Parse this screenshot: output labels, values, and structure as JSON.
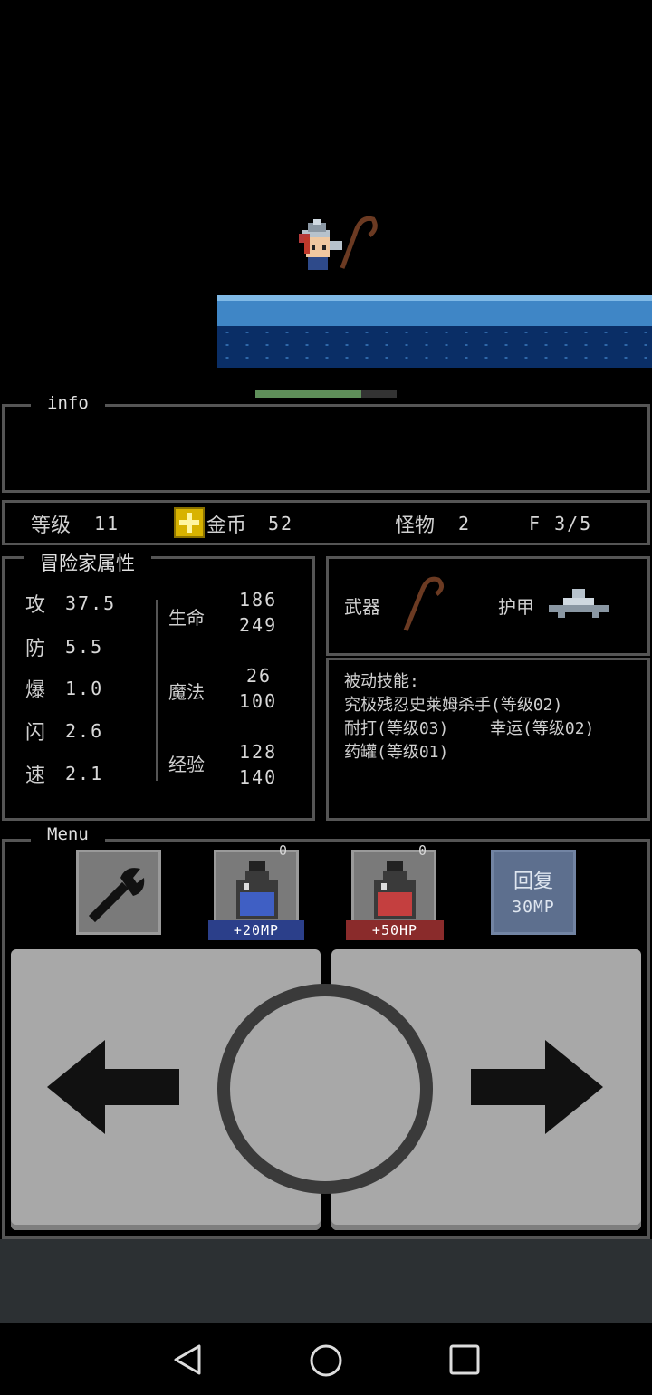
{
  "info": {
    "title": "info"
  },
  "status": {
    "level_label": "等级",
    "level_value": "11",
    "gold_label": "金币",
    "gold_value": "52",
    "monster_label": "怪物",
    "monster_value": "2",
    "floor": "F 3/5"
  },
  "hero_hp_fraction": 0.75,
  "attributes": {
    "title": "冒险家属性",
    "stats": [
      {
        "label": "攻",
        "value": "37.5"
      },
      {
        "label": "防",
        "value": "5.5"
      },
      {
        "label": "爆",
        "value": "1.0"
      },
      {
        "label": "闪",
        "value": "2.6"
      },
      {
        "label": "速",
        "value": "2.1"
      }
    ],
    "life_label": "生命",
    "life_cur": "186",
    "life_max": "249",
    "magic_label": "魔法",
    "magic_cur": "26",
    "magic_max": "100",
    "exp_label": "经验",
    "exp_cur": "128",
    "exp_max": "140"
  },
  "equipment": {
    "weapon_label": "武器",
    "armor_label": "护甲"
  },
  "skills": {
    "title": "被动技能:",
    "line1": "究极残忍史莱姆杀手(等级02)",
    "line2a": "耐打(等级03)",
    "line2b": "幸运(等级02)",
    "line3": "药罐(等级01)"
  },
  "menu": {
    "title": "Menu",
    "mp_potion_count": "0",
    "mp_potion_label": "+20MP",
    "hp_potion_count": "0",
    "hp_potion_label": "+50HP",
    "restore_line1": "回复",
    "restore_line2": "30MP"
  },
  "colors": {
    "mp_label_bg": "#2b3f8a",
    "hp_label_bg": "#8a2b2b",
    "restore_bg": "#5d6f8e"
  }
}
